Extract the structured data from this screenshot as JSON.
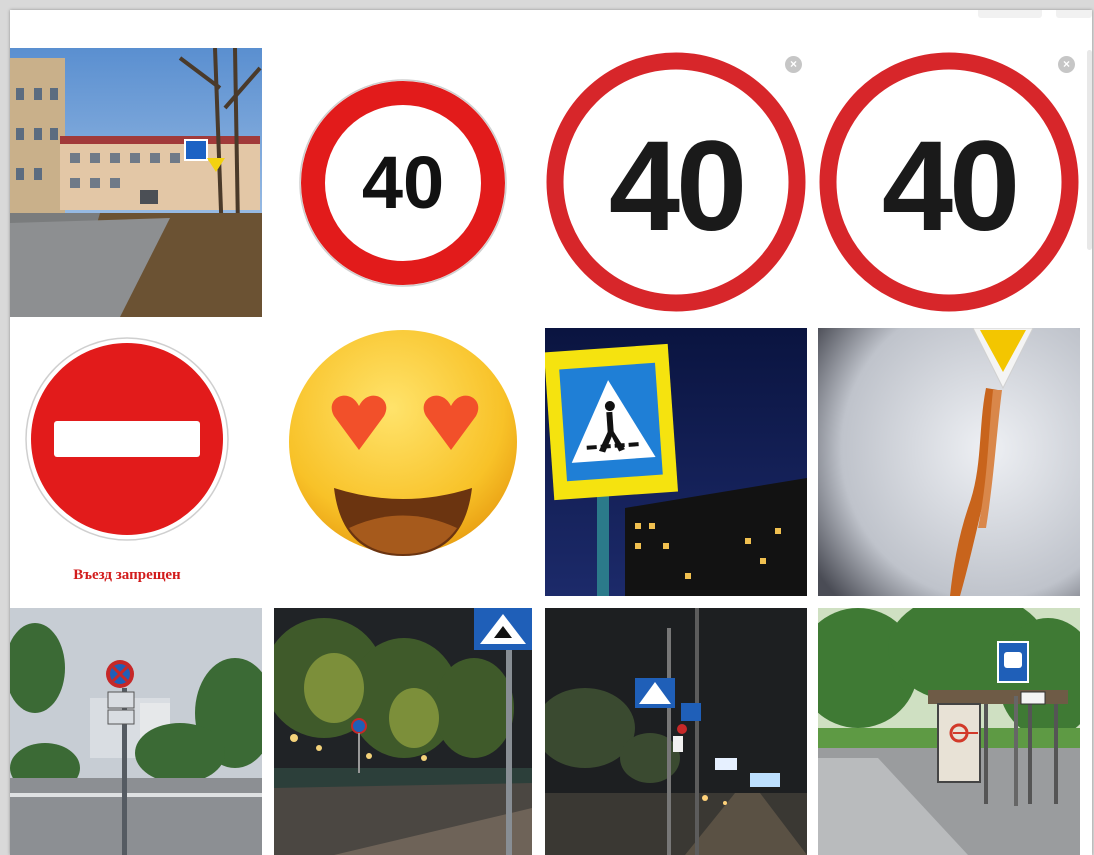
{
  "colors": {
    "sign_red": "#e21b1b",
    "sign_red_dark": "#d7262a",
    "sign_blue": "#1f7fd6",
    "sign_yellow": "#f5e30f",
    "caption_red": "#d21c1c",
    "close_badge": "#c6c6c6"
  },
  "grid": {
    "tiles": [
      {
        "name": "street-photo-day",
        "type": "photo"
      },
      {
        "name": "speed-limit-40-sign",
        "type": "sign",
        "text": "40"
      },
      {
        "name": "speed-limit-40-large",
        "type": "sign",
        "text": "40",
        "has_close": true
      },
      {
        "name": "speed-limit-40-large-2",
        "type": "sign",
        "text": "40",
        "has_close": true
      },
      {
        "name": "no-entry-sign",
        "type": "sign",
        "caption": "Въезд запрещен"
      },
      {
        "name": "heart-eyes-emoji",
        "type": "emoji"
      },
      {
        "name": "pedestrian-crossing-night",
        "type": "photo"
      },
      {
        "name": "priority-road-drawing",
        "type": "photo"
      },
      {
        "name": "no-stopping-street-photo",
        "type": "photo"
      },
      {
        "name": "speed-bump-sign-night",
        "type": "photo"
      },
      {
        "name": "night-street-signs",
        "type": "photo"
      },
      {
        "name": "bus-stop-photo",
        "type": "photo"
      }
    ]
  },
  "labels": {
    "tile_2_number": "40",
    "tile_3_number": "40",
    "tile_4_number": "40",
    "tile_5_caption": "Въезд запрещен",
    "close_glyph": "×"
  }
}
